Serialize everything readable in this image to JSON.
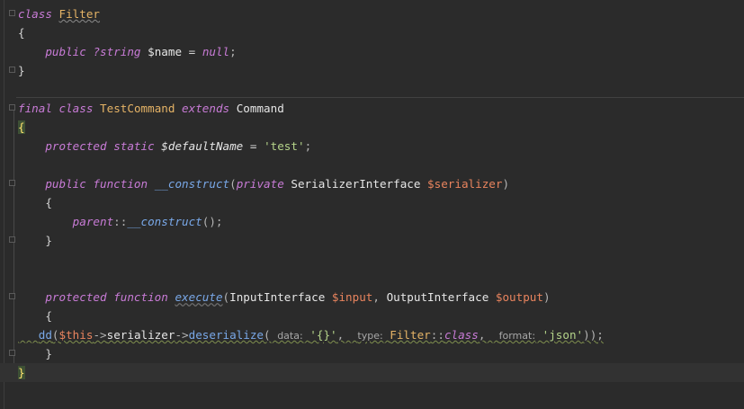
{
  "code": {
    "l1": {
      "kw": "class",
      "name": "Filter"
    },
    "l2": {
      "brace": "{"
    },
    "l3": {
      "kw": "public",
      "type": "?string",
      "var": "$name",
      "op": "=",
      "val": "null",
      "end": ";"
    },
    "l4": {
      "brace": "}"
    },
    "l5": {
      "kw1": "final",
      "kw2": "class",
      "name": "TestCommand",
      "kw3": "extends",
      "parent": "Command"
    },
    "l6": {
      "brace": "{"
    },
    "l7": {
      "kw1": "protected",
      "kw2": "static",
      "var": "$defaultName",
      "op": "=",
      "val": "'test'",
      "end": ";"
    },
    "l8": {
      "kw1": "public",
      "kw2": "function",
      "fn": "__construct",
      "open": "(",
      "kw3": "private",
      "type": "SerializerInterface",
      "var": "$serializer",
      "close": ")"
    },
    "l9": {
      "brace": "{"
    },
    "l10": {
      "kw": "parent",
      "sep": "::",
      "fn": "__construct",
      "rest": "();"
    },
    "l11": {
      "brace": "}"
    },
    "l12": {
      "kw1": "protected",
      "kw2": "function",
      "fn": "execute",
      "open": "(",
      "type1": "InputInterface",
      "var1": "$input",
      "comma": ",",
      "type2": "OutputInterface",
      "var2": "$output",
      "close": ")"
    },
    "l13": {
      "brace": "{"
    },
    "l14": {
      "fn": "dd",
      "open": "(",
      "this": "$this",
      "arrow1": "->",
      "prop": "serializer",
      "arrow2": "->",
      "method": "deserialize",
      "open2": "(",
      "hint1": "data:",
      "arg1": "'{}'",
      "comma1": ",",
      "hint2": "type:",
      "cls": "Filter",
      "sep": "::",
      "kwclass": "class",
      "comma2": ",",
      "hint3": "format:",
      "arg3": "'json'",
      "close": "));"
    },
    "l15": {
      "brace": "}"
    },
    "l16": {
      "brace": "}"
    }
  },
  "colors": {
    "background": "#2b2b2b",
    "keyword": "#c87bd6",
    "class_name": "#e5b366",
    "string": "#b5d48a",
    "property_var": "#e9845e",
    "function": "#79a8e8"
  }
}
